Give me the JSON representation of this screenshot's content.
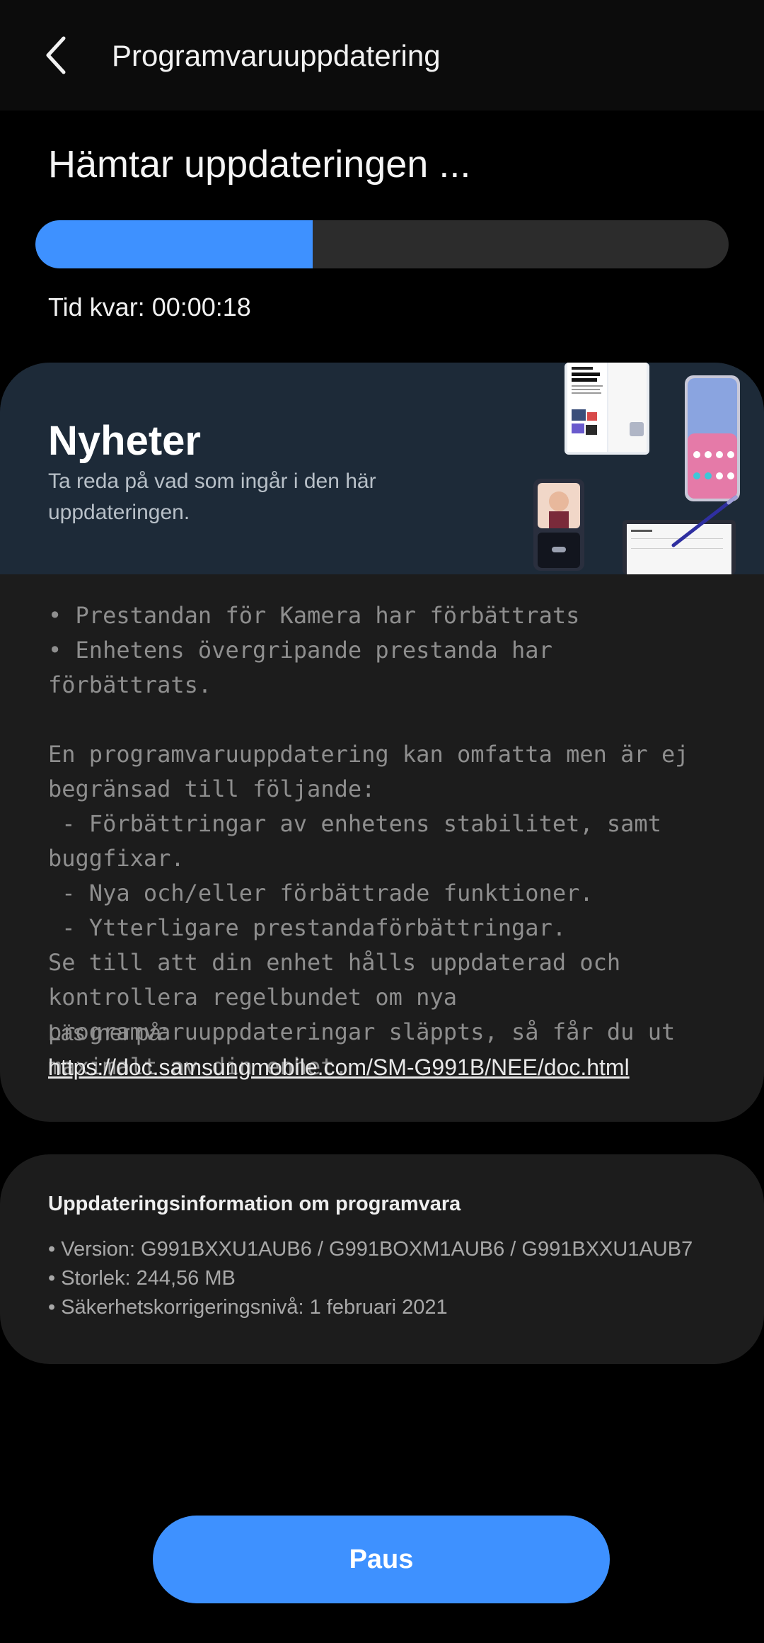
{
  "app_bar": {
    "title": "Programvaruuppdatering",
    "back_icon": "chevron-left-icon"
  },
  "download": {
    "status_title": "Hämtar uppdateringen ...",
    "progress_percent": 40,
    "progress_color": "#3e91ff",
    "track_color": "#2c2c2c",
    "time_left": "Tid kvar: 00:00:18"
  },
  "whats_new": {
    "title": "Nyheter",
    "subtitle": "Ta reda på vad som ingår i den här uppdateringen.",
    "banner_color": "#1d2a38",
    "notes": "• Prestandan för Kamera har förbättrats\n• Enhetens övergripande prestanda har förbättrats.\n\nEn programvaruuppdatering kan omfatta men är ej begränsad till följande:\n - Förbättringar av enhetens stabilitet, samt buggfixar.\n - Nya och/eller förbättrade funktioner.\n - Ytterligare prestandaförbättringar.\nSe till att din enhet hålls uppdaterad och kontrollera regelbundet om nya programvaruuppdateringar släppts, så får du ut maximalt av din enhet.",
    "read_more_label": "Läs mer på:",
    "read_more_url": "https://doc.samsungmobile.com/SM-G991B/NEE/doc.html"
  },
  "software_info": {
    "title": "Uppdateringsinformation om programvara",
    "items": [
      "• Version: G991BXXU1AUB6 / G991BOXM1AUB6 / G991BXXU1AUB7",
      "• Storlek: 244,56 MB",
      "• Säkerhetskorrigeringsnivå: 1 februari 2021"
    ]
  },
  "actions": {
    "pause_label": "Paus",
    "accent_color": "#3e91ff"
  }
}
